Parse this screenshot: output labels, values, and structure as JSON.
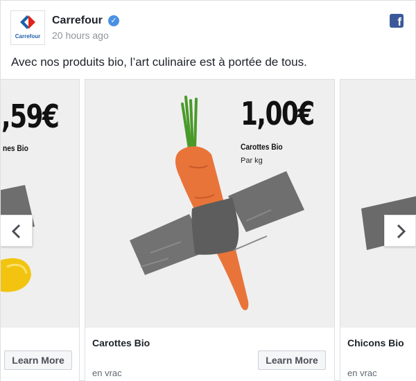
{
  "post": {
    "page_name": "Carrefour",
    "time": "20 hours ago",
    "text": "Avec nos produits bio, l’art culinaire est à portée de tous.",
    "logo_word": "Carrefour"
  },
  "colors": {
    "facebook_blue": "#3b5998",
    "verified_blue": "#4a90e2",
    "carrefour_blue": "#1d5ea8",
    "carrefour_red": "#e2231a"
  },
  "carousel": {
    "prev_card": {
      "price": ",59€",
      "label": "nes Bio",
      "button": "Learn More"
    },
    "main_card": {
      "price": "1,00€",
      "label": "Carottes Bio",
      "unit": "Par kg",
      "title": "Carottes Bio",
      "subtitle": "en vrac",
      "button": "Learn More"
    },
    "next_card": {
      "title": "Chicons Bio",
      "subtitle": "en vrac"
    }
  }
}
